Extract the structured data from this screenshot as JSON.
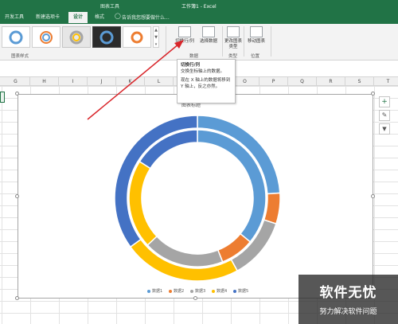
{
  "window": {
    "title": "工作簿1 - Excel",
    "context_tab": "图表工具"
  },
  "tabs": [
    {
      "label": "开发工具",
      "active": false
    },
    {
      "label": "新建选项卡",
      "active": false
    },
    {
      "label": "设计",
      "active": true
    },
    {
      "label": "格式",
      "active": false
    }
  ],
  "search": {
    "placeholder": "告诉我您想要做什么..."
  },
  "ribbon": {
    "group_chart_styles": "图表样式",
    "switch_row_col": "切换行/列",
    "select_data": "选择数据",
    "group_data": "数据",
    "change_chart_type": "更改图表类型",
    "group_type": "类型",
    "move_chart": "移动图表",
    "group_location": "位置"
  },
  "tooltip": {
    "title": "切换行/列",
    "line1": "交换坐标轴上的数据。",
    "line2": "现在 X 轴上的数据将移到 Y 轴上，反之亦然。"
  },
  "columns": [
    "G",
    "H",
    "I",
    "J",
    "K",
    "L",
    "M",
    "N",
    "O",
    "P",
    "Q",
    "R",
    "S",
    "T"
  ],
  "chart": {
    "title_partial": "图表标题",
    "side_buttons": [
      "+",
      "✎",
      "▼"
    ]
  },
  "chart_data": {
    "type": "doughnut",
    "series_names": [
      "数据1",
      "数据2",
      "数据3",
      "数据4",
      "数据5"
    ],
    "colors": [
      "#5b9bd5",
      "#ed7d31",
      "#a5a5a5",
      "#ffc000",
      "#4472c4"
    ],
    "rings": [
      {
        "name": "outer",
        "values": [
          24,
          6,
          12,
          23,
          35
        ]
      },
      {
        "name": "inner",
        "values": [
          36,
          8,
          19,
          21,
          16
        ]
      }
    ]
  },
  "watermark": {
    "title": "软件无忧",
    "subtitle": "努力解决软件问题"
  }
}
